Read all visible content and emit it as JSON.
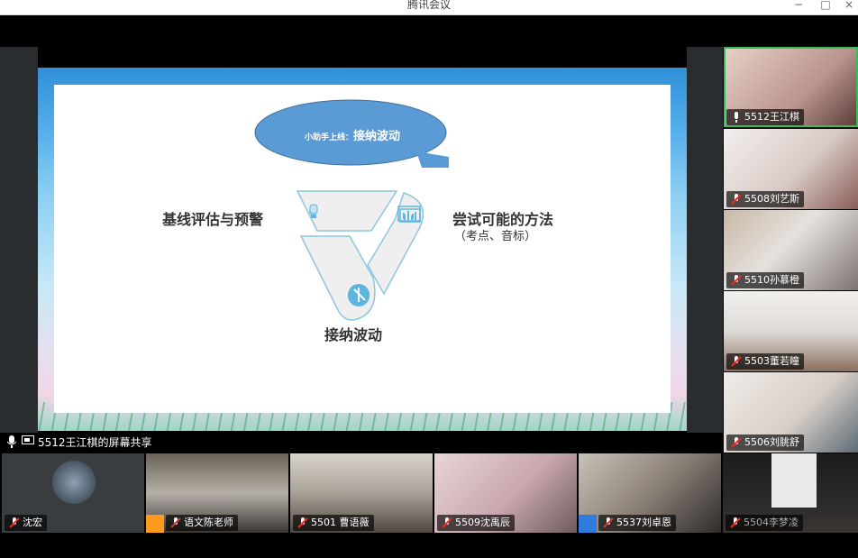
{
  "window": {
    "title": "腾讯会议",
    "controls": [
      "−",
      "□",
      "×"
    ]
  },
  "slide": {
    "bubble_small": "小助手上线：",
    "bubble_big": "接纳波动",
    "left_label": "基线评估与预警",
    "right_label": "尝试可能的方法",
    "right_sublabel": "（考点、音标）",
    "bottom_label": "接纳波动"
  },
  "share_status": "5512王江棋的屏幕共享",
  "side_participants": [
    {
      "name": "5512王江棋",
      "active": true
    },
    {
      "name": "5508刘艺斯",
      "muted": true
    },
    {
      "name": "5510孙慕橙",
      "muted": true
    },
    {
      "name": "5503董若瞳",
      "muted": true
    },
    {
      "name": "5506刘朓舒",
      "muted": true
    }
  ],
  "bottom_participants": [
    {
      "name": "沈宏",
      "muted": true
    },
    {
      "name": "语文陈老师",
      "muted": true,
      "badge": "host"
    },
    {
      "name": "5501 曹语薇",
      "muted": true
    },
    {
      "name": "5509沈禹辰",
      "muted": true
    },
    {
      "name": "5537刘卓恩",
      "muted": true,
      "badge": "cohost"
    },
    {
      "name": "5504李梦凌",
      "muted": true
    }
  ],
  "colors": {
    "accent_green": "#2fbf5b",
    "bubble_blue": "#5b9bd5",
    "mute_red": "#e0302a"
  }
}
